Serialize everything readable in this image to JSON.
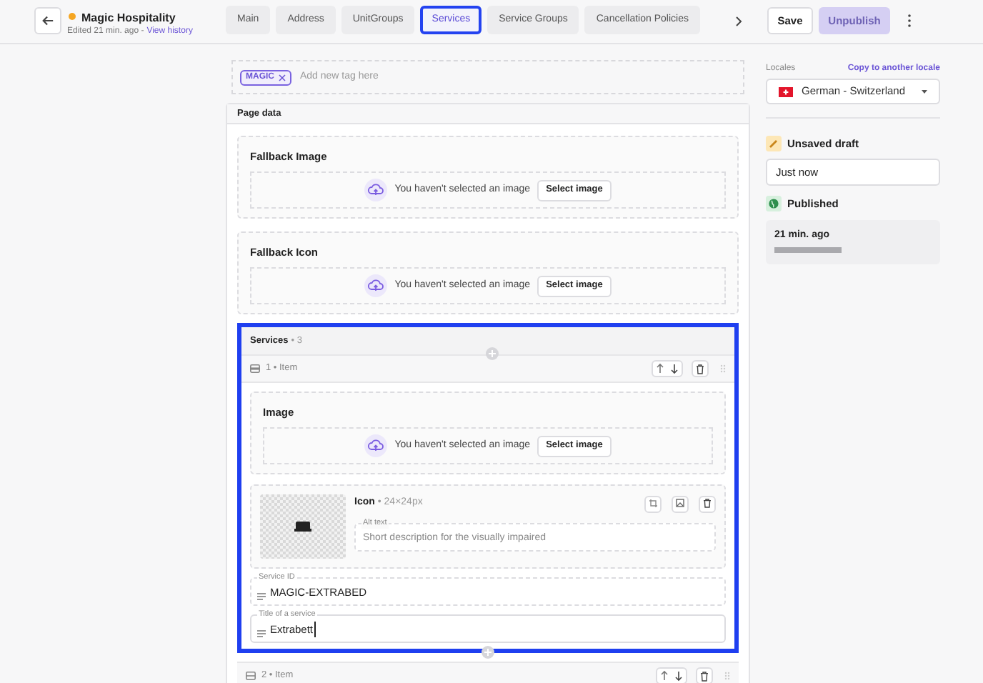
{
  "header": {
    "title": "Magic Hospitality",
    "subtitle": "Edited 21 min. ago -",
    "history_link": "View history",
    "unsaved": true
  },
  "tabs": [
    {
      "label": "Main",
      "selected": false
    },
    {
      "label": "Address",
      "selected": false
    },
    {
      "label": "UnitGroups",
      "selected": false
    },
    {
      "label": "Services",
      "selected": true
    },
    {
      "label": "Service Groups",
      "selected": false
    },
    {
      "label": "Cancellation Policies",
      "selected": false
    }
  ],
  "actions": {
    "save": "Save",
    "unpublish": "Unpublish",
    "unpublish_disabled": true
  },
  "tags": [
    {
      "label": "MAGIC"
    }
  ],
  "tag_placeholder": "Add new tag here",
  "page_data": {
    "title": "Page data",
    "sections": [
      {
        "title": "Fallback Image",
        "empty_text": "You haven't selected an image",
        "button": "Select image"
      },
      {
        "title": "Fallback Icon",
        "empty_text": "You haven't selected an image",
        "button": "Select image"
      }
    ],
    "services": {
      "title": "Services",
      "count": "• 3",
      "selected": true,
      "items": [
        {
          "number": "1",
          "label": "• Item",
          "expanded": true,
          "image": {
            "title": "Image",
            "empty_text": "You haven't selected an image",
            "button": "Select image"
          },
          "icon": {
            "title": "Icon",
            "size": "• 24×24px",
            "alt_label": "Alt text",
            "alt_placeholder": "Short description for the visually impaired"
          },
          "service_id": {
            "label": "Service ID",
            "value": "MAGIC-EXTRABED"
          },
          "service_title": {
            "label": "Title of a service",
            "value": "Extrabett"
          }
        },
        {
          "number": "2",
          "label": "• Item",
          "expanded": false
        }
      ]
    }
  },
  "sidebar": {
    "locales_label": "Locales",
    "copy_link": "Copy to another locale",
    "locale": "German - Switzerland",
    "draft": {
      "title": "Unsaved draft",
      "time": "Just now"
    },
    "published": {
      "title": "Published",
      "time": "21 min. ago"
    }
  }
}
